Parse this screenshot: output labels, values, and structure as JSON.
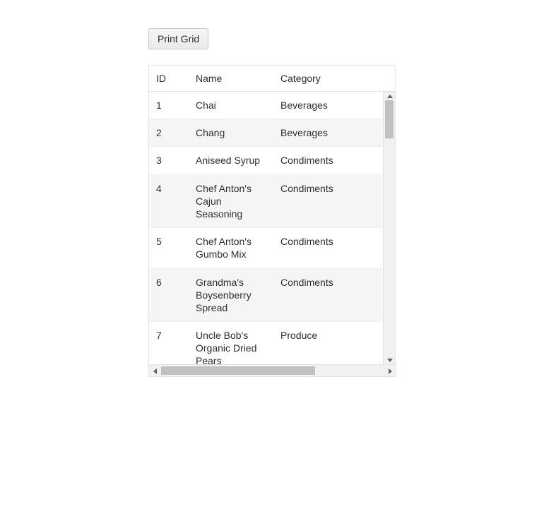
{
  "toolbar": {
    "print_label": "Print Grid"
  },
  "grid": {
    "columns": {
      "id": "ID",
      "name": "Name",
      "category": "Category"
    },
    "rows": [
      {
        "id": "1",
        "name": "Chai",
        "category": "Beverages"
      },
      {
        "id": "2",
        "name": "Chang",
        "category": "Beverages"
      },
      {
        "id": "3",
        "name": "Aniseed Syrup",
        "category": "Condiments"
      },
      {
        "id": "4",
        "name": "Chef Anton's Cajun Seasoning",
        "category": "Condiments"
      },
      {
        "id": "5",
        "name": "Chef Anton's Gumbo Mix",
        "category": "Condiments"
      },
      {
        "id": "6",
        "name": "Grandma's Boysenberry Spread",
        "category": "Condiments"
      },
      {
        "id": "7",
        "name": "Uncle Bob's Organic Dried Pears",
        "category": "Produce"
      }
    ]
  }
}
